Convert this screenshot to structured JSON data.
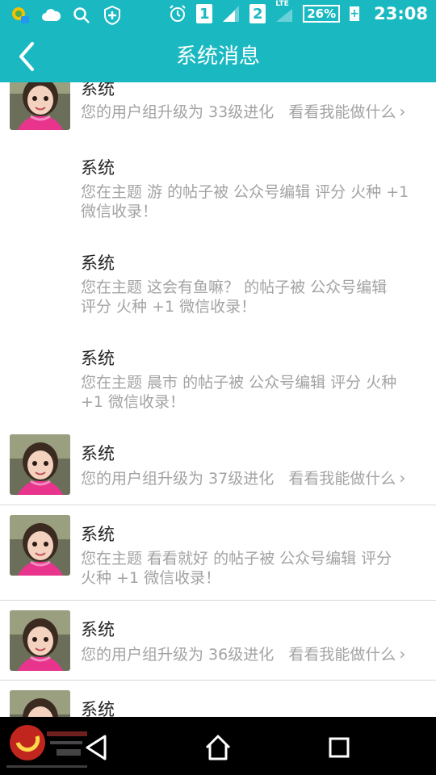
{
  "status_bar": {
    "time": "23:08",
    "battery": "26%",
    "battery_plus": "+",
    "sim1": "1",
    "sim2": "2",
    "network_type": "LTE",
    "icons": [
      "app-notification-icon",
      "cloud-icon",
      "search-icon",
      "shield-icon",
      "alarm-icon",
      "signal-icon",
      "signal-icon"
    ]
  },
  "header": {
    "title": "系统消息",
    "back_icon": "chevron-left-icon"
  },
  "messages": [
    {
      "sender": "系统",
      "text": "您的用户组升级为 33级进化",
      "link": "看看我能做什么",
      "chevron": "›"
    },
    {
      "sender": "系统",
      "line1": "您在主题 游 的帖子被 公众号编辑 评分 火种 +1",
      "line2": "微信收录！"
    },
    {
      "sender": "系统",
      "line1": "您在主题 这会有鱼嘛？ 的帖子被 公众号编辑",
      "line2": "评分 火种 +1  微信收录！"
    },
    {
      "sender": "系统",
      "line1": "您在主题 晨市 的帖子被 公众号编辑 评分 火种",
      "line2": "+1  微信收录！"
    },
    {
      "sender": "系统",
      "text": "您的用户组升级为 37级进化",
      "link": "看看我能做什么",
      "chevron": "›"
    },
    {
      "sender": "系统",
      "line1": "您在主题 看看就好 的帖子被 公众号编辑 评分",
      "line2": "火种 +1  微信收录！"
    },
    {
      "sender": "系统",
      "text": "您的用户组升级为 36级进化",
      "link": "看看我能做什么",
      "chevron": "›"
    },
    {
      "sender": "系统"
    }
  ],
  "nav_bar": {
    "icons": [
      "back-triangle-icon",
      "home-icon",
      "recents-icon"
    ],
    "watermark": "dragon-logo"
  },
  "colors": {
    "accent": "#1ab9c2",
    "secondary_text": "#a3a3a3",
    "primary_text": "#222222"
  }
}
